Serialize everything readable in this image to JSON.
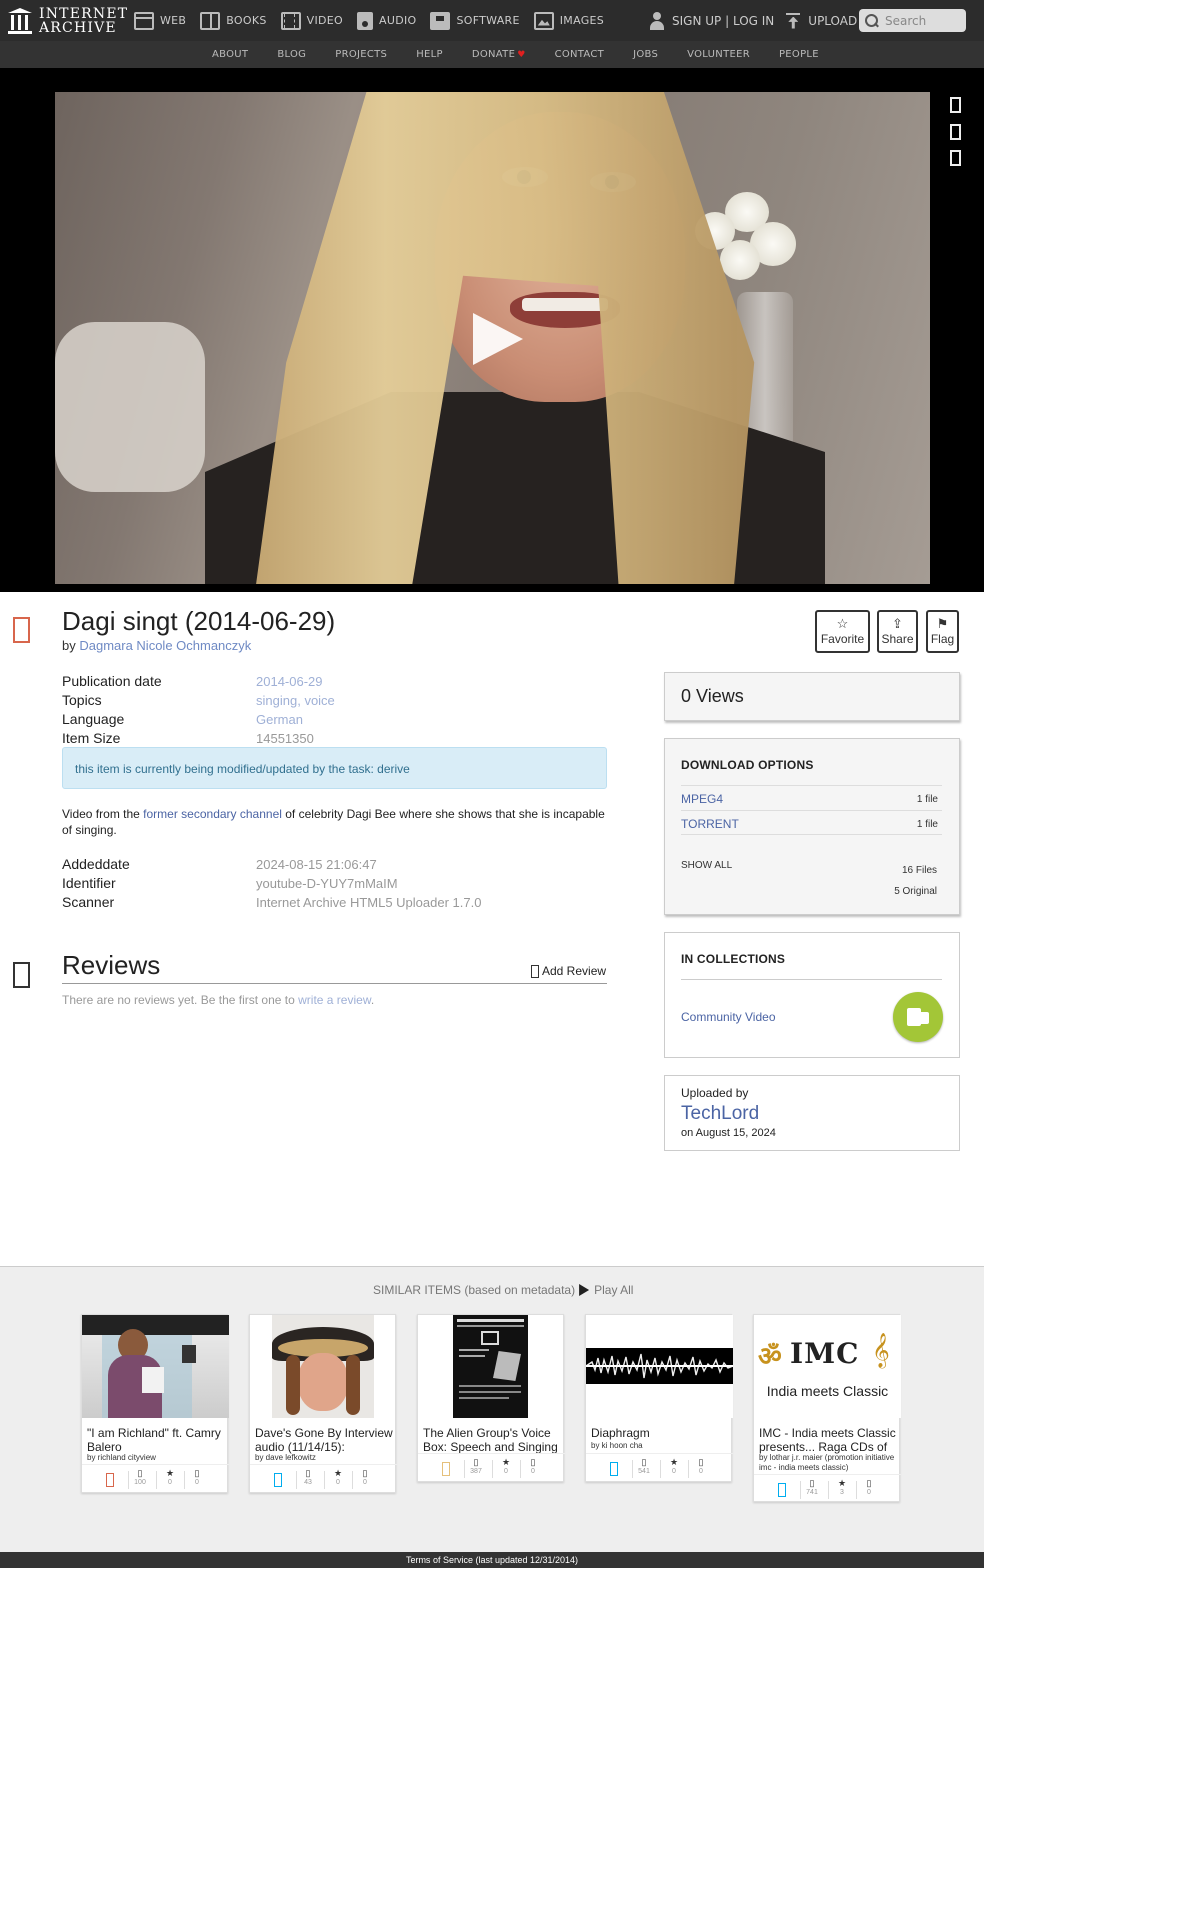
{
  "nav": {
    "logo_line1": "INTERNET",
    "logo_line2": "ARCHIVE",
    "media": [
      {
        "label": "WEB",
        "icon": "web-icon"
      },
      {
        "label": "BOOKS",
        "icon": "books-icon"
      },
      {
        "label": "VIDEO",
        "icon": "video-icon"
      },
      {
        "label": "AUDIO",
        "icon": "audio-icon"
      },
      {
        "label": "SOFTWARE",
        "icon": "software-icon"
      },
      {
        "label": "IMAGES",
        "icon": "images-icon"
      }
    ],
    "signup_login": "SIGN UP | LOG IN",
    "upload": "UPLOAD",
    "search_placeholder": "Search",
    "sub": [
      "ABOUT",
      "BLOG",
      "PROJECTS",
      "HELP",
      "DONATE",
      "CONTACT",
      "JOBS",
      "VOLUNTEER",
      "PEOPLE"
    ],
    "donate_heart": "♥"
  },
  "item": {
    "title": "Dagi singt (2014-06-29)",
    "by_label": "by ",
    "creator": "Dagmara Nicole Ochmanczyk",
    "actions": [
      {
        "label": "Favorite",
        "glyph": "☆"
      },
      {
        "label": "Share",
        "glyph": "⇪"
      },
      {
        "label": "Flag",
        "glyph": "⚑"
      }
    ],
    "metadata": [
      {
        "label": "Publication date",
        "value": "2014-06-29"
      },
      {
        "label": "Topics",
        "value_parts": [
          "singing",
          ", ",
          "voice"
        ]
      },
      {
        "label": "Language",
        "value": "German"
      },
      {
        "label": "Item Size",
        "value": "14551350"
      }
    ],
    "notice": "this item is currently being modified/updated by the task: derive",
    "description": {
      "before": "Video from the ",
      "link": "former secondary channel",
      "after": " of celebrity Dagi Bee where she shows that she is incapable of singing."
    },
    "metadata2": [
      {
        "label": "Addeddate",
        "value": "2024-08-15 21:06:47"
      },
      {
        "label": "Identifier",
        "value": "youtube-D-YUY7mMaIM"
      },
      {
        "label": "Scanner",
        "value": "Internet Archive HTML5 Uploader 1.7.0"
      }
    ]
  },
  "reviews": {
    "title": "Reviews",
    "add_label": "Add Review",
    "empty_before": "There are no reviews yet. Be the first one to ",
    "empty_link": "write a review",
    "empty_after": "."
  },
  "sidebar": {
    "views": "0 Views",
    "download_head": "DOWNLOAD OPTIONS",
    "downloads": [
      {
        "format": "MPEG4",
        "count": "1 file"
      },
      {
        "format": "TORRENT",
        "count": "1 file"
      }
    ],
    "show_all": "SHOW ALL",
    "total_files": "16 Files",
    "original_files": "5 Original",
    "collections_head": "IN COLLECTIONS",
    "collection": "Community Video",
    "uploaded_by_label": "Uploaded by",
    "uploader": "TechLord",
    "upload_date": "on August 15, 2024"
  },
  "similar": {
    "heading": "SIMILAR ITEMS (based on metadata)",
    "play_all": "Play All",
    "items": [
      {
        "title": "\"I am Richland\" ft. Camry Balero",
        "by": "by richland cityview",
        "views": "100",
        "favs": "0",
        "reviews": "0",
        "type": "movies"
      },
      {
        "title": "Dave's Gone By Interview audio (11/14/15):",
        "by": "by dave lefkowitz",
        "views": "43",
        "favs": "0",
        "reviews": "0",
        "type": "audio"
      },
      {
        "title": "The Alien Group's Voice Box: Speech and Singing",
        "by": "",
        "views": "387",
        "favs": "0",
        "reviews": "0",
        "type": "texts"
      },
      {
        "title": "Diaphragm",
        "by": "by ki hoon cha",
        "views": "541",
        "favs": "0",
        "reviews": "0",
        "type": "audio"
      },
      {
        "title": "IMC - India meets Classic presents... Raga CDs of",
        "by": "by lothar j.r. maier (promotion initiative imc - india meets classic)",
        "views": "741",
        "favs": "3",
        "reviews": "0",
        "type": "audio"
      }
    ],
    "imc_logo": "IMC",
    "imc_caption": "India meets Classic"
  },
  "footer": "Terms of Service (last updated 12/31/2014)",
  "colors": {
    "link": "#4b64a4",
    "nav_bg": "#2c2c2c",
    "notice_bg": "#d9edf7",
    "collection_badge": "#a3c637",
    "texts_type": "#d8664c",
    "audio_type": "#00adef",
    "donate_heart": "#e02020"
  }
}
